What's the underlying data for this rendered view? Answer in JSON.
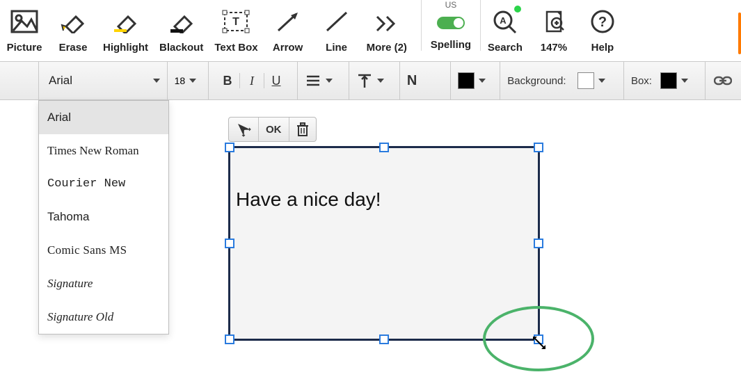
{
  "toolbar": {
    "picture": "Picture",
    "erase": "Erase",
    "highlight": "Highlight",
    "blackout": "Blackout",
    "textbox": "Text Box",
    "arrow": "Arrow",
    "line": "Line",
    "more": "More (2)",
    "spelling": "Spelling",
    "spelling_lang": "US",
    "search": "Search",
    "zoom": "147%",
    "help": "Help"
  },
  "format": {
    "font_name": "Arial",
    "font_size": "18",
    "bold": "B",
    "italic": "I",
    "underline": "U",
    "dir": "N",
    "text_color": "#000000",
    "background_label": "Background:",
    "background_color": "#ffffff",
    "box_label": "Box:",
    "box_color": "#000000"
  },
  "font_options": [
    {
      "label": "Arial",
      "css": "",
      "active": true
    },
    {
      "label": "Times New Roman",
      "css": "ff-times"
    },
    {
      "label": "Courier New",
      "css": "ff-courier"
    },
    {
      "label": "Tahoma",
      "css": "ff-tahoma"
    },
    {
      "label": "Comic Sans MS",
      "css": "ff-comic"
    },
    {
      "label": "Signature",
      "css": "ff-sig"
    },
    {
      "label": "Signature Old",
      "css": "ff-sigold"
    }
  ],
  "mini_toolbar": {
    "ok": "OK"
  },
  "textbox": {
    "content": "Have a nice day!"
  }
}
